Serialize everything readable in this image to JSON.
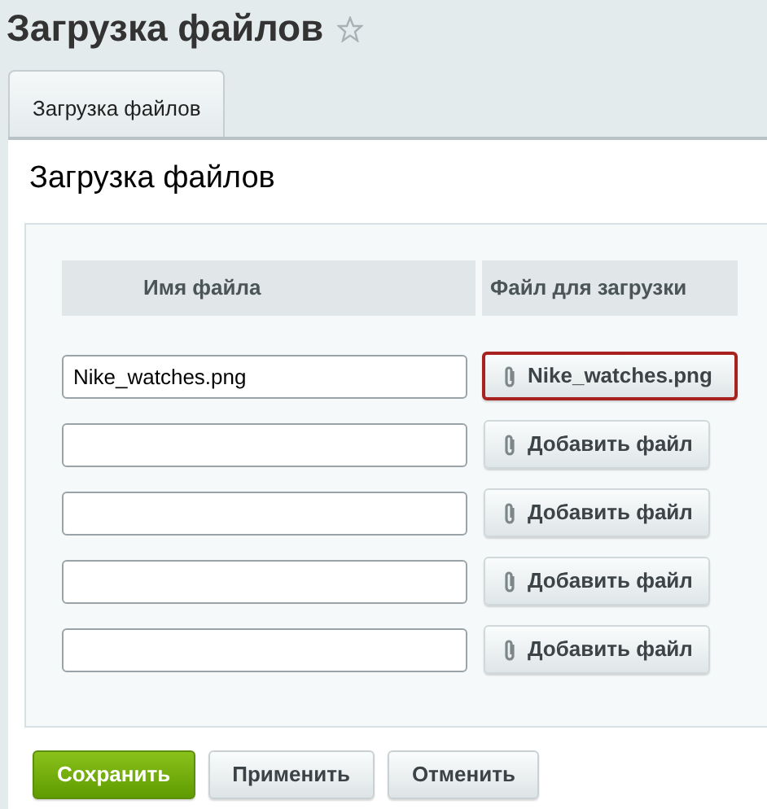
{
  "page_title": "Загрузка файлов",
  "favorite": false,
  "tabs": [
    {
      "label": "Загрузка файлов",
      "selected": true
    }
  ],
  "section_title": "Загрузка файлов",
  "table": {
    "columns": [
      "Имя файла",
      "Файл для загрузки"
    ],
    "rows": [
      {
        "name": "Nike_watches.png",
        "file_button": "Nike_watches.png",
        "selected": true
      },
      {
        "name": "",
        "file_button": "Добавить файл",
        "selected": false
      },
      {
        "name": "",
        "file_button": "Добавить файл",
        "selected": false
      },
      {
        "name": "",
        "file_button": "Добавить файл",
        "selected": false
      },
      {
        "name": "",
        "file_button": "Добавить файл",
        "selected": false
      }
    ]
  },
  "buttons": [
    {
      "label": "Сохранить",
      "kind": "primary"
    },
    {
      "label": "Применить",
      "kind": "default"
    },
    {
      "label": "Отменить",
      "kind": "default"
    }
  ]
}
